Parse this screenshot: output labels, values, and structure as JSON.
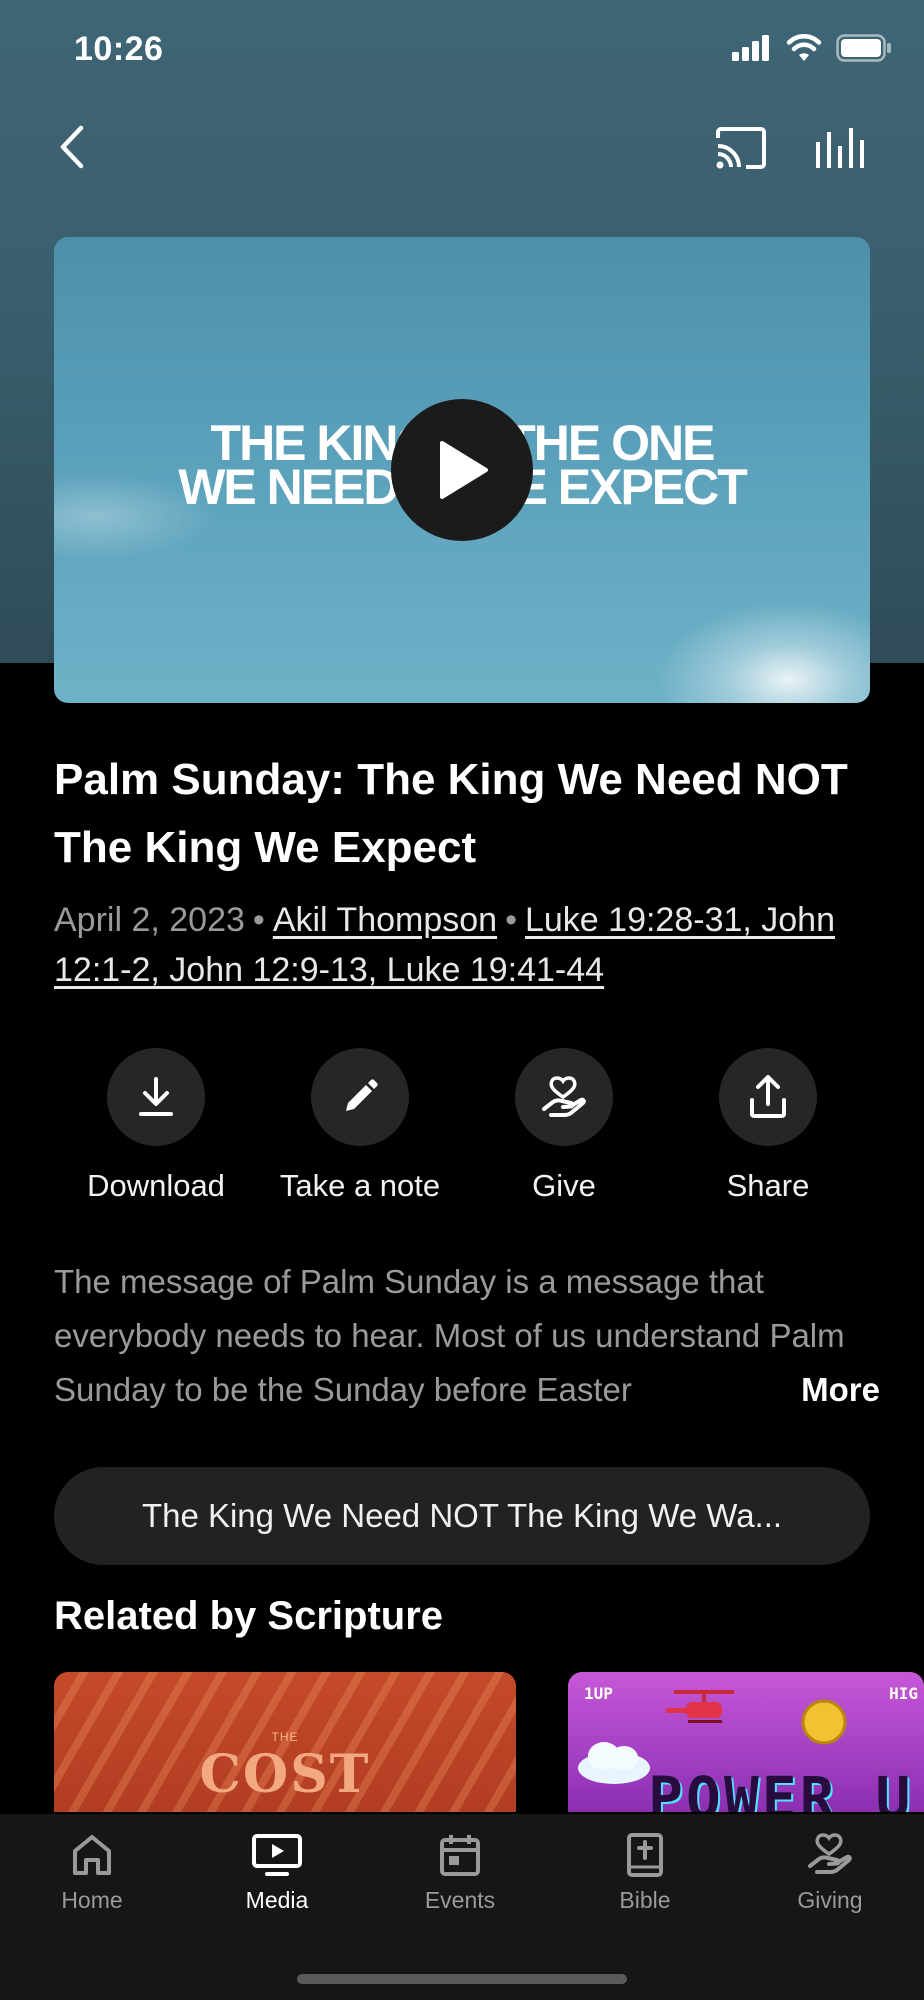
{
  "status_bar": {
    "time": "10:26"
  },
  "header": {
    "back_icon": "chevron-left-icon",
    "cast_icon": "cast-icon",
    "audio_icon": "audio-bars-icon"
  },
  "video": {
    "thumbnail_line1": "THE KING — THE ONE",
    "thumbnail_line2": "WE NEED — WE EXPECT",
    "play_icon": "play-icon"
  },
  "sermon": {
    "title": "Palm Sunday: The King We Need NOT The King We Expect",
    "date": "April 2, 2023",
    "speaker": "Akil Thompson",
    "scripture": "Luke 19:28-31, John 12:1-2, John 12:9-13, Luke 19:41-44"
  },
  "actions": [
    {
      "label": "Download",
      "icon": "download-icon"
    },
    {
      "label": "Take a note",
      "icon": "pencil-icon"
    },
    {
      "label": "Give",
      "icon": "giving-hand-heart-icon"
    },
    {
      "label": "Share",
      "icon": "share-icon"
    }
  ],
  "description": {
    "text": "The message of Palm Sunday is a message that everybody needs to hear. Most of us understand Palm Sunday to be the Sunday before Easter",
    "more_label": "More"
  },
  "series_pill": {
    "label": "The King We Need NOT The King We Wa..."
  },
  "related": {
    "title": "Related by Scripture",
    "cards": [
      {
        "small_text": "THE",
        "big_text": "COST"
      },
      {
        "hud_left": "1UP",
        "hud_right": "HIG",
        "big_text": "POWER U"
      }
    ]
  },
  "tabbar": {
    "tabs": [
      {
        "label": "Home",
        "icon": "home-icon",
        "active": false
      },
      {
        "label": "Media",
        "icon": "tv-icon",
        "active": true
      },
      {
        "label": "Events",
        "icon": "calendar-icon",
        "active": false
      },
      {
        "label": "Bible",
        "icon": "bible-icon",
        "active": false
      },
      {
        "label": "Giving",
        "icon": "giving-hand-heart-icon",
        "active": false
      }
    ]
  },
  "colors": {
    "background": "#000000",
    "hero": "#3f6676",
    "surface": "#262626",
    "muted_text": "#9a9a9a"
  }
}
